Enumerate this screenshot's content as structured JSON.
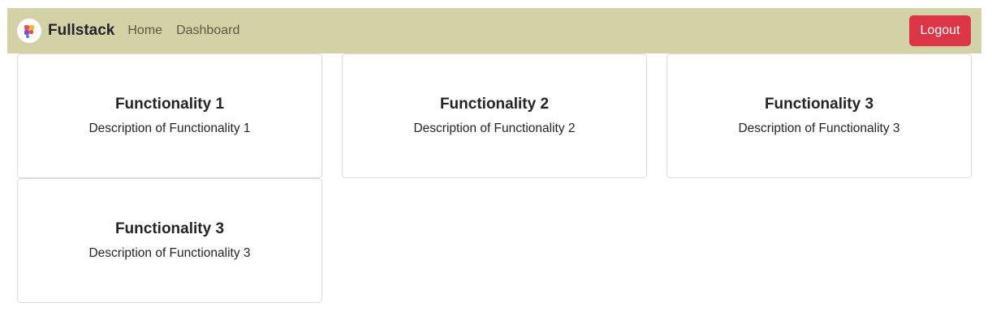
{
  "navbar": {
    "logo_icon": "colorful-blocks-logo",
    "brand": "Fullstack",
    "links": [
      "Home",
      "Dashboard"
    ],
    "logout_label": "Logout",
    "background_color": "#d3d1a6",
    "logout_color": "#dc3545"
  },
  "cards": [
    {
      "title": "Functionality 1",
      "description": "Description of Functionality 1"
    },
    {
      "title": "Functionality 2",
      "description": "Description of Functionality 2"
    },
    {
      "title": "Functionality 3",
      "description": "Description of Functionality 3"
    },
    {
      "title": "Functionality 3",
      "description": "Description of Functionality 3"
    }
  ]
}
